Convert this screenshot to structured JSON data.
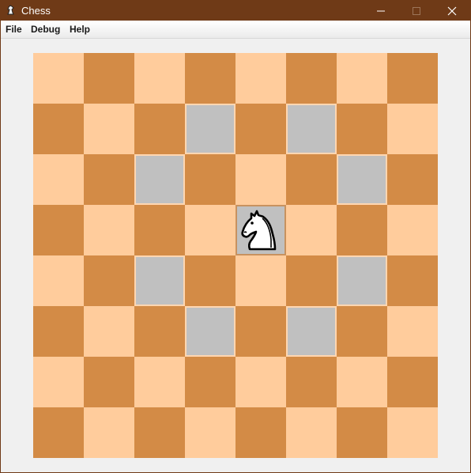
{
  "window": {
    "title": "Chess",
    "titlebar_color": "#6f3a17",
    "icon": "chess-app-icon",
    "controls": [
      "minimize-icon",
      "maximize-icon",
      "close-icon"
    ]
  },
  "menubar": {
    "file_label": "File",
    "debug_label": "Debug",
    "help_label": "Help"
  },
  "board": {
    "files": 8,
    "ranks": 8,
    "colors": {
      "light": "#ffcc9c",
      "dark": "#d38b46",
      "highlight": "#c0c0c0"
    },
    "pieces": [
      {
        "piece": "white-knight-icon",
        "row": 3,
        "col": 4
      }
    ],
    "selected": {
      "row": 3,
      "col": 4
    },
    "legal_moves": [
      {
        "row": 1,
        "col": 3
      },
      {
        "row": 1,
        "col": 5
      },
      {
        "row": 2,
        "col": 2
      },
      {
        "row": 2,
        "col": 6
      },
      {
        "row": 4,
        "col": 2
      },
      {
        "row": 4,
        "col": 6
      },
      {
        "row": 5,
        "col": 3
      },
      {
        "row": 5,
        "col": 5
      }
    ]
  }
}
